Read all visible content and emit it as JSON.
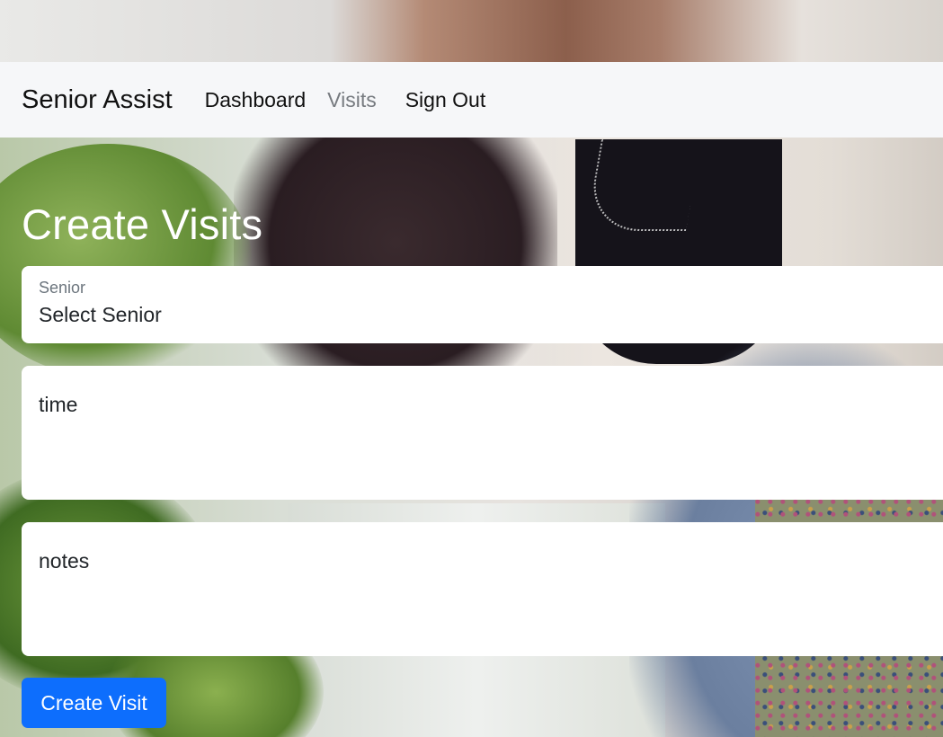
{
  "navbar": {
    "brand": "Senior Assist",
    "links": [
      "Dashboard",
      "Visits",
      "Sign Out"
    ]
  },
  "main": {
    "title": "Create Visits",
    "senior_field": {
      "label": "Senior",
      "selected": "Select Senior"
    },
    "time_field": {
      "placeholder": "time"
    },
    "notes_field": {
      "placeholder": "notes"
    },
    "submit_label": "Create Visit"
  },
  "colors": {
    "navbar_bg": "#f6f7f9",
    "primary": "#0d6efd",
    "muted_link": "#777b80"
  }
}
